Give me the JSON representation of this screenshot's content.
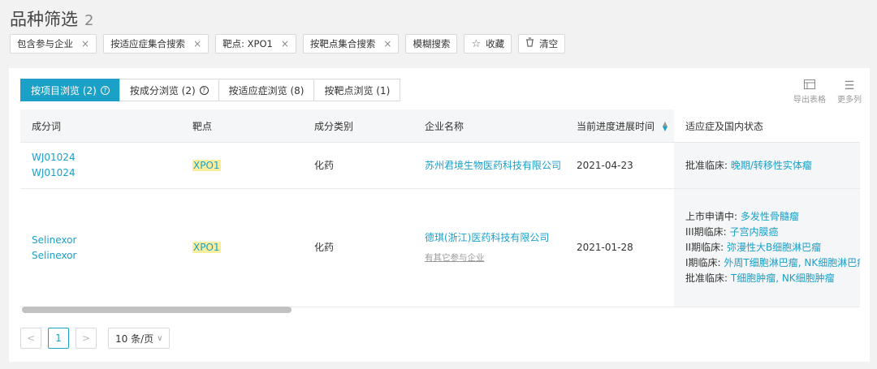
{
  "header": {
    "title": "品种筛选",
    "count": "2"
  },
  "filters": [
    {
      "label": "包含参与企业",
      "close": "×"
    },
    {
      "label": "按适应症集合搜索",
      "close": "×"
    },
    {
      "label": "靶点: XPO1",
      "close": "×"
    },
    {
      "label": "按靶点集合搜索",
      "close": "×"
    },
    {
      "label": "模糊搜索"
    },
    {
      "label": "收藏",
      "icon": "star-icon"
    },
    {
      "label": "清空",
      "icon": "trash-icon"
    }
  ],
  "tabs": [
    {
      "label": "按项目浏览 (2)",
      "active": true
    },
    {
      "label": "按成分浏览 (2)",
      "active": false
    },
    {
      "label": "按适应症浏览 (8)",
      "active": false
    },
    {
      "label": "按靶点浏览 (1)",
      "active": false
    }
  ],
  "tools": {
    "export_label": "导出表格",
    "more_label": "更多列"
  },
  "table": {
    "columns": [
      "成分词",
      "靶点",
      "成分类别",
      "企业名称",
      "当前进度进展时间",
      "适应症及国内状态"
    ],
    "rows": [
      {
        "ingredient": [
          "WJ01024",
          "WJ01024"
        ],
        "target": "XPO1",
        "category": "化药",
        "company": "苏州君境生物医药科技有限公司",
        "company_note": "",
        "date": "2021-04-23",
        "status": [
          {
            "phase": "批准临床:",
            "items": "晚期/转移性实体瘤"
          }
        ]
      },
      {
        "ingredient": [
          "Selinexor",
          "Selinexor"
        ],
        "target": "XPO1",
        "category": "化药",
        "company": "德琪(浙江)医药科技有限公司",
        "company_note": "有其它参与企业",
        "date": "2021-01-28",
        "status": [
          {
            "phase": "上市申请中:",
            "items": "多发性骨髓瘤"
          },
          {
            "phase": "III期临床:",
            "items": "子宫内膜癌"
          },
          {
            "phase": "II期临床:",
            "items": "弥漫性大B细胞淋巴瘤"
          },
          {
            "phase": "I期临床:",
            "items": "外周T细胞淋巴瘤, NK细胞淋巴瘤"
          },
          {
            "phase": "批准临床:",
            "items": "T细胞肿瘤, NK细胞肿瘤"
          }
        ]
      }
    ]
  },
  "pagination": {
    "prev": "<",
    "current": "1",
    "next": ">",
    "page_size": "10 条/页"
  },
  "colors": {
    "accent": "#1ba0c8",
    "highlight": "#fbed9e",
    "background": "#f2f2f2"
  }
}
